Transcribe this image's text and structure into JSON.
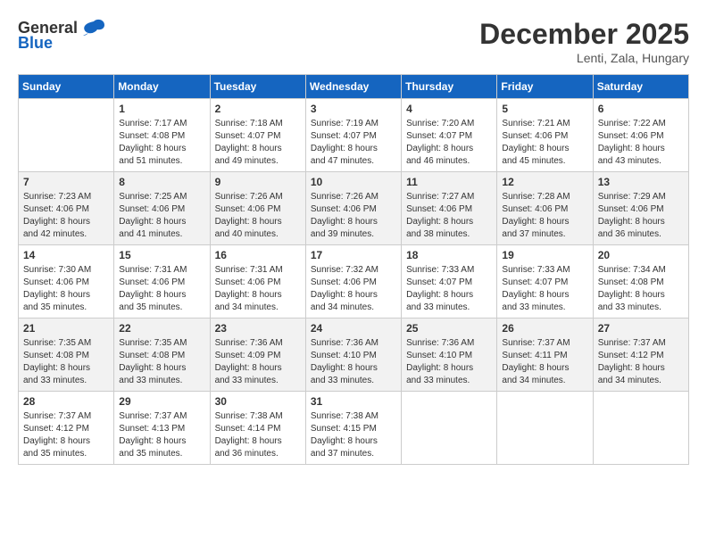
{
  "logo": {
    "general": "General",
    "blue": "Blue"
  },
  "header": {
    "month": "December 2025",
    "location": "Lenti, Zala, Hungary"
  },
  "weekdays": [
    "Sunday",
    "Monday",
    "Tuesday",
    "Wednesday",
    "Thursday",
    "Friday",
    "Saturday"
  ],
  "weeks": [
    [
      {
        "day": "",
        "info": ""
      },
      {
        "day": "1",
        "info": "Sunrise: 7:17 AM\nSunset: 4:08 PM\nDaylight: 8 hours\nand 51 minutes."
      },
      {
        "day": "2",
        "info": "Sunrise: 7:18 AM\nSunset: 4:07 PM\nDaylight: 8 hours\nand 49 minutes."
      },
      {
        "day": "3",
        "info": "Sunrise: 7:19 AM\nSunset: 4:07 PM\nDaylight: 8 hours\nand 47 minutes."
      },
      {
        "day": "4",
        "info": "Sunrise: 7:20 AM\nSunset: 4:07 PM\nDaylight: 8 hours\nand 46 minutes."
      },
      {
        "day": "5",
        "info": "Sunrise: 7:21 AM\nSunset: 4:06 PM\nDaylight: 8 hours\nand 45 minutes."
      },
      {
        "day": "6",
        "info": "Sunrise: 7:22 AM\nSunset: 4:06 PM\nDaylight: 8 hours\nand 43 minutes."
      }
    ],
    [
      {
        "day": "7",
        "info": "Sunrise: 7:23 AM\nSunset: 4:06 PM\nDaylight: 8 hours\nand 42 minutes."
      },
      {
        "day": "8",
        "info": "Sunrise: 7:25 AM\nSunset: 4:06 PM\nDaylight: 8 hours\nand 41 minutes."
      },
      {
        "day": "9",
        "info": "Sunrise: 7:26 AM\nSunset: 4:06 PM\nDaylight: 8 hours\nand 40 minutes."
      },
      {
        "day": "10",
        "info": "Sunrise: 7:26 AM\nSunset: 4:06 PM\nDaylight: 8 hours\nand 39 minutes."
      },
      {
        "day": "11",
        "info": "Sunrise: 7:27 AM\nSunset: 4:06 PM\nDaylight: 8 hours\nand 38 minutes."
      },
      {
        "day": "12",
        "info": "Sunrise: 7:28 AM\nSunset: 4:06 PM\nDaylight: 8 hours\nand 37 minutes."
      },
      {
        "day": "13",
        "info": "Sunrise: 7:29 AM\nSunset: 4:06 PM\nDaylight: 8 hours\nand 36 minutes."
      }
    ],
    [
      {
        "day": "14",
        "info": "Sunrise: 7:30 AM\nSunset: 4:06 PM\nDaylight: 8 hours\nand 35 minutes."
      },
      {
        "day": "15",
        "info": "Sunrise: 7:31 AM\nSunset: 4:06 PM\nDaylight: 8 hours\nand 35 minutes."
      },
      {
        "day": "16",
        "info": "Sunrise: 7:31 AM\nSunset: 4:06 PM\nDaylight: 8 hours\nand 34 minutes."
      },
      {
        "day": "17",
        "info": "Sunrise: 7:32 AM\nSunset: 4:06 PM\nDaylight: 8 hours\nand 34 minutes."
      },
      {
        "day": "18",
        "info": "Sunrise: 7:33 AM\nSunset: 4:07 PM\nDaylight: 8 hours\nand 33 minutes."
      },
      {
        "day": "19",
        "info": "Sunrise: 7:33 AM\nSunset: 4:07 PM\nDaylight: 8 hours\nand 33 minutes."
      },
      {
        "day": "20",
        "info": "Sunrise: 7:34 AM\nSunset: 4:08 PM\nDaylight: 8 hours\nand 33 minutes."
      }
    ],
    [
      {
        "day": "21",
        "info": "Sunrise: 7:35 AM\nSunset: 4:08 PM\nDaylight: 8 hours\nand 33 minutes."
      },
      {
        "day": "22",
        "info": "Sunrise: 7:35 AM\nSunset: 4:08 PM\nDaylight: 8 hours\nand 33 minutes."
      },
      {
        "day": "23",
        "info": "Sunrise: 7:36 AM\nSunset: 4:09 PM\nDaylight: 8 hours\nand 33 minutes."
      },
      {
        "day": "24",
        "info": "Sunrise: 7:36 AM\nSunset: 4:10 PM\nDaylight: 8 hours\nand 33 minutes."
      },
      {
        "day": "25",
        "info": "Sunrise: 7:36 AM\nSunset: 4:10 PM\nDaylight: 8 hours\nand 33 minutes."
      },
      {
        "day": "26",
        "info": "Sunrise: 7:37 AM\nSunset: 4:11 PM\nDaylight: 8 hours\nand 34 minutes."
      },
      {
        "day": "27",
        "info": "Sunrise: 7:37 AM\nSunset: 4:12 PM\nDaylight: 8 hours\nand 34 minutes."
      }
    ],
    [
      {
        "day": "28",
        "info": "Sunrise: 7:37 AM\nSunset: 4:12 PM\nDaylight: 8 hours\nand 35 minutes."
      },
      {
        "day": "29",
        "info": "Sunrise: 7:37 AM\nSunset: 4:13 PM\nDaylight: 8 hours\nand 35 minutes."
      },
      {
        "day": "30",
        "info": "Sunrise: 7:38 AM\nSunset: 4:14 PM\nDaylight: 8 hours\nand 36 minutes."
      },
      {
        "day": "31",
        "info": "Sunrise: 7:38 AM\nSunset: 4:15 PM\nDaylight: 8 hours\nand 37 minutes."
      },
      {
        "day": "",
        "info": ""
      },
      {
        "day": "",
        "info": ""
      },
      {
        "day": "",
        "info": ""
      }
    ]
  ]
}
